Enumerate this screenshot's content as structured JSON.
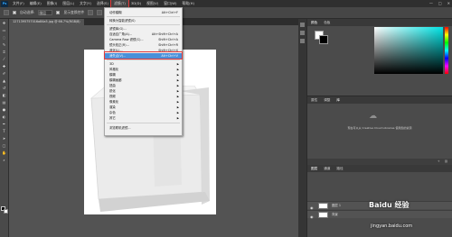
{
  "app": {
    "logo": "Ps",
    "window_controls": [
      "—",
      "□",
      "✕"
    ]
  },
  "menubar": [
    "文件(F)",
    "编辑(E)",
    "图像(I)",
    "图层(L)",
    "文字(Y)",
    "选择(S)",
    "滤镜(T)",
    "3D(D)",
    "视图(V)",
    "窗口(W)",
    "帮助(H)"
  ],
  "options_bar": {
    "auto_select": "自动选择:",
    "layer": "图层",
    "show_transform": "显示变换控件"
  },
  "document_tab": "1271395757016a84a5.jpg @ 66.7%(RGB/8)",
  "filter_menu": {
    "items": [
      {
        "label": "动作模糊",
        "shortcut": "Alt+Ctrl+F"
      },
      {
        "label": "转换为智能滤镜(S)",
        "shortcut": ""
      },
      {
        "label": "滤镜库(G)...",
        "shortcut": ""
      },
      {
        "label": "自适应广角(A)...",
        "shortcut": "Alt+Shift+Ctrl+A"
      },
      {
        "label": "Camera Raw 滤镜(C)...",
        "shortcut": "Shift+Ctrl+A"
      },
      {
        "label": "镜头校正(R)...",
        "shortcut": "Shift+Ctrl+R"
      },
      {
        "label": "液化(L)...",
        "shortcut": "Shift+Ctrl+X"
      },
      {
        "label": "消失点(V)...",
        "shortcut": "Alt+Ctrl+V"
      },
      {
        "label": "3D",
        "shortcut": ""
      },
      {
        "label": "风格化",
        "shortcut": ""
      },
      {
        "label": "模糊",
        "shortcut": ""
      },
      {
        "label": "模糊画廊",
        "shortcut": ""
      },
      {
        "label": "扭曲",
        "shortcut": ""
      },
      {
        "label": "锐化",
        "shortcut": ""
      },
      {
        "label": "视频",
        "shortcut": ""
      },
      {
        "label": "像素化",
        "shortcut": ""
      },
      {
        "label": "渲染",
        "shortcut": ""
      },
      {
        "label": "杂色",
        "shortcut": ""
      },
      {
        "label": "其它",
        "shortcut": ""
      },
      {
        "label": "浏览联机滤镜...",
        "shortcut": ""
      }
    ]
  },
  "right_panel": {
    "color_tabs": [
      "颜色",
      "色板"
    ],
    "library_tabs": [
      "属性",
      "调整",
      "库"
    ],
    "library_text": "现在可以从 Creative Cloud Libraries 使用您的资源",
    "layers_tabs": [
      "图层",
      "通道",
      "路径"
    ],
    "layers": [
      {
        "name": "图层 1"
      },
      {
        "name": "背景"
      }
    ]
  },
  "watermark": {
    "brand": "Baidu 经验",
    "url": "jingyan.baidu.com"
  },
  "colors": {
    "accent_red": "#e23b3b",
    "highlight_blue": "#4a90d9"
  }
}
